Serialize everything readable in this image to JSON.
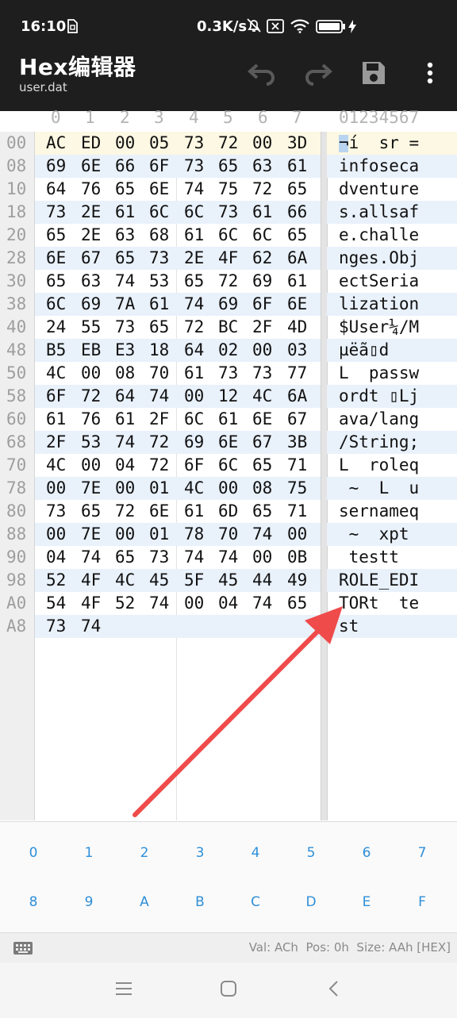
{
  "status_bar": {
    "time": "16:10",
    "network_speed": "0.3K/s",
    "icons": [
      "sim-icon",
      "bell-muted-icon",
      "no-sim-icon",
      "wifi-icon",
      "battery-icon",
      "charging-icon"
    ]
  },
  "app": {
    "title": "Hex编辑器",
    "filename": "user.dat",
    "toolbar": [
      "undo-icon",
      "redo-icon",
      "save-icon",
      "more-vert-icon"
    ]
  },
  "columns": {
    "hex": [
      "0",
      "1",
      "2",
      "3",
      "4",
      "5",
      "6",
      "7"
    ],
    "ascii_header": "01234567"
  },
  "rows": [
    {
      "offset": "00",
      "bytes": [
        "AC",
        "ED",
        "00",
        "05",
        "73",
        "72",
        "00",
        "3D"
      ],
      "ascii": "¬í  sr ="
    },
    {
      "offset": "08",
      "bytes": [
        "69",
        "6E",
        "66",
        "6F",
        "73",
        "65",
        "63",
        "61"
      ],
      "ascii": "infoseca"
    },
    {
      "offset": "10",
      "bytes": [
        "64",
        "76",
        "65",
        "6E",
        "74",
        "75",
        "72",
        "65"
      ],
      "ascii": "dventure"
    },
    {
      "offset": "18",
      "bytes": [
        "73",
        "2E",
        "61",
        "6C",
        "6C",
        "73",
        "61",
        "66"
      ],
      "ascii": "s.allsaf"
    },
    {
      "offset": "20",
      "bytes": [
        "65",
        "2E",
        "63",
        "68",
        "61",
        "6C",
        "6C",
        "65"
      ],
      "ascii": "e.challe"
    },
    {
      "offset": "28",
      "bytes": [
        "6E",
        "67",
        "65",
        "73",
        "2E",
        "4F",
        "62",
        "6A"
      ],
      "ascii": "nges.Obj"
    },
    {
      "offset": "30",
      "bytes": [
        "65",
        "63",
        "74",
        "53",
        "65",
        "72",
        "69",
        "61"
      ],
      "ascii": "ectSeria"
    },
    {
      "offset": "38",
      "bytes": [
        "6C",
        "69",
        "7A",
        "61",
        "74",
        "69",
        "6F",
        "6E"
      ],
      "ascii": "lization"
    },
    {
      "offset": "40",
      "bytes": [
        "24",
        "55",
        "73",
        "65",
        "72",
        "BC",
        "2F",
        "4D"
      ],
      "ascii": "$User¼/M"
    },
    {
      "offset": "48",
      "bytes": [
        "B5",
        "EB",
        "E3",
        "18",
        "64",
        "02",
        "00",
        "03"
      ],
      "ascii": "µëã▯d"
    },
    {
      "offset": "50",
      "bytes": [
        "4C",
        "00",
        "08",
        "70",
        "61",
        "73",
        "73",
        "77"
      ],
      "ascii": "L  passw"
    },
    {
      "offset": "58",
      "bytes": [
        "6F",
        "72",
        "64",
        "74",
        "00",
        "12",
        "4C",
        "6A"
      ],
      "ascii": "ordt ▯Lj"
    },
    {
      "offset": "60",
      "bytes": [
        "61",
        "76",
        "61",
        "2F",
        "6C",
        "61",
        "6E",
        "67"
      ],
      "ascii": "ava/lang"
    },
    {
      "offset": "68",
      "bytes": [
        "2F",
        "53",
        "74",
        "72",
        "69",
        "6E",
        "67",
        "3B"
      ],
      "ascii": "/String;"
    },
    {
      "offset": "70",
      "bytes": [
        "4C",
        "00",
        "04",
        "72",
        "6F",
        "6C",
        "65",
        "71"
      ],
      "ascii": "L  roleq"
    },
    {
      "offset": "78",
      "bytes": [
        "00",
        "7E",
        "00",
        "01",
        "4C",
        "00",
        "08",
        "75"
      ],
      "ascii": " ~  L  u"
    },
    {
      "offset": "80",
      "bytes": [
        "73",
        "65",
        "72",
        "6E",
        "61",
        "6D",
        "65",
        "71"
      ],
      "ascii": "sernameq"
    },
    {
      "offset": "88",
      "bytes": [
        "00",
        "7E",
        "00",
        "01",
        "78",
        "70",
        "74",
        "00"
      ],
      "ascii": " ~  xpt "
    },
    {
      "offset": "90",
      "bytes": [
        "04",
        "74",
        "65",
        "73",
        "74",
        "74",
        "00",
        "0B"
      ],
      "ascii": " testt  "
    },
    {
      "offset": "98",
      "bytes": [
        "52",
        "4F",
        "4C",
        "45",
        "5F",
        "45",
        "44",
        "49"
      ],
      "ascii": "ROLE_EDI"
    },
    {
      "offset": "A0",
      "bytes": [
        "54",
        "4F",
        "52",
        "74",
        "00",
        "04",
        "74",
        "65"
      ],
      "ascii": "TORt  te"
    },
    {
      "offset": "A8",
      "bytes": [
        "73",
        "74"
      ],
      "ascii": "st"
    }
  ],
  "keypad": [
    "0",
    "1",
    "2",
    "3",
    "4",
    "5",
    "6",
    "7",
    "8",
    "9",
    "A",
    "B",
    "C",
    "D",
    "E",
    "F"
  ],
  "info": {
    "val": "Val: ACh",
    "pos": "Pos: 0h",
    "size": "Size: AAh [HEX]"
  },
  "nav": [
    "menu-icon",
    "home-icon",
    "back-icon"
  ],
  "colors": {
    "appbar": "#1e1e1e",
    "accent": "#2f8fd8",
    "arrow": "#ef4b4b",
    "row_alt": "#e9f1fb",
    "row_selected": "#fdf8e3"
  }
}
